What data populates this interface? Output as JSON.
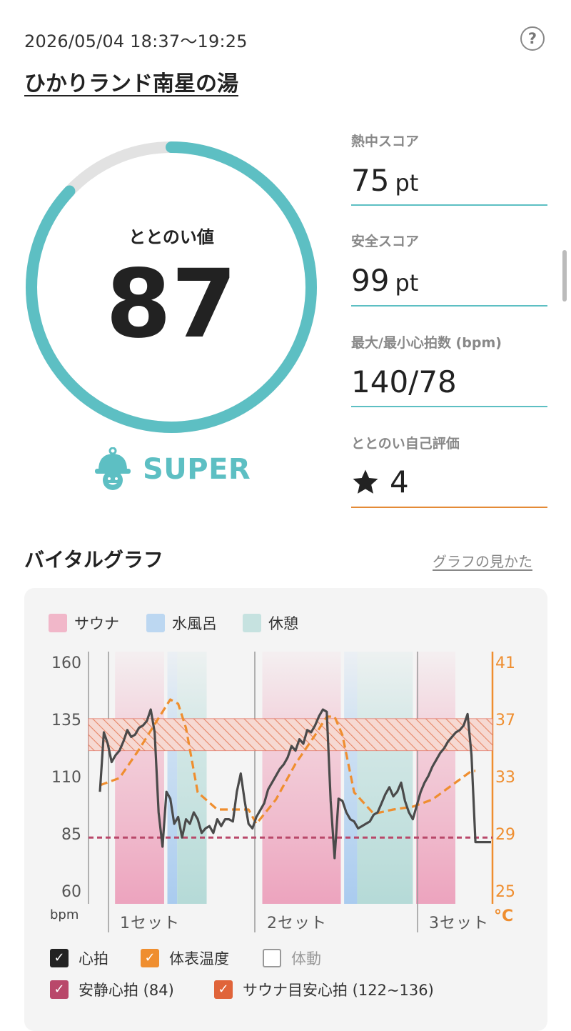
{
  "session": {
    "datetime": "2026/05/04 18:37〜19:25",
    "venue": "ひかりランド南星の湯",
    "help_icon": "question-circle-icon"
  },
  "score": {
    "label": "ととのい値",
    "value": "87",
    "progress": 0.87,
    "rank": "SUPER",
    "rank_icon": "sauna-hat-mascot-icon",
    "accent": "#5dbfc3",
    "track": "#e2e2e2"
  },
  "stats": [
    {
      "label": "熱中スコア",
      "value": "75",
      "unit": "pt",
      "line_color": "#5dbfc3"
    },
    {
      "label": "安全スコア",
      "value": "99",
      "unit": "pt",
      "line_color": "#5dbfc3"
    },
    {
      "label": "最大/最小心拍数 (bpm)",
      "value": "140/78",
      "unit": "",
      "line_color": "#5dbfc3"
    },
    {
      "label": "ととのい自己評価",
      "value": "4",
      "unit": "",
      "icon": "star-icon",
      "line_color": "#e48a36"
    }
  ],
  "vital": {
    "title": "バイタルグラフ",
    "guide_link": "グラフの見かた",
    "legend": [
      {
        "label": "サウナ",
        "color": "#f1b7c9"
      },
      {
        "label": "水風呂",
        "color": "#bcd7f1"
      },
      {
        "label": "休憩",
        "color": "#c6e2e0"
      }
    ],
    "toggles": [
      {
        "label": "心拍",
        "checked": true,
        "color": "#222222"
      },
      {
        "label": "体表温度",
        "checked": true,
        "color": "#ef8e2f"
      },
      {
        "label": "体動",
        "checked": false,
        "color": "#999999"
      },
      {
        "label": "安静心拍 (84)",
        "checked": true,
        "color": "#b9486a"
      },
      {
        "label": "サウナ目安心拍 (122~136)",
        "checked": true,
        "color": "#e0643a"
      }
    ]
  },
  "chart_data": {
    "type": "line",
    "y_left": {
      "unit": "bpm",
      "ticks": [
        160,
        135,
        110,
        85,
        60
      ],
      "range": [
        60,
        160
      ]
    },
    "y_right": {
      "unit": "°C",
      "ticks": [
        41,
        37,
        33,
        29,
        25
      ],
      "range": [
        25,
        41
      ]
    },
    "x_labels": [
      "1セット",
      "2セット",
      "3セット"
    ],
    "resting_hr": 84,
    "sauna_target_hr": [
      122,
      136
    ],
    "phases": [
      {
        "type": "サウナ",
        "start": 0.02,
        "end": 0.17
      },
      {
        "type": "水風呂",
        "start": 0.18,
        "end": 0.21
      },
      {
        "type": "休憩",
        "start": 0.21,
        "end": 0.3
      },
      {
        "type": "サウナ",
        "start": 0.47,
        "end": 0.71
      },
      {
        "type": "水風呂",
        "start": 0.72,
        "end": 0.76
      },
      {
        "type": "休憩",
        "start": 0.76,
        "end": 0.93
      },
      {
        "type": "サウナ",
        "start": 0.94,
        "end": 1.06
      },
      {
        "type": "水風呂",
        "start": 1.18,
        "end": 1.2
      }
    ],
    "series": [
      {
        "name": "心拍",
        "t": [
          0,
          1,
          2,
          3,
          4,
          5,
          6,
          7,
          8,
          9,
          10,
          11,
          12,
          13,
          14,
          15,
          16,
          17,
          18,
          19,
          20,
          21,
          22,
          23,
          24,
          25,
          26,
          27,
          28,
          29,
          30,
          31,
          32,
          33,
          34,
          35,
          36,
          37,
          38,
          39,
          40,
          41,
          42,
          43,
          44,
          45,
          46,
          47,
          48,
          49,
          50,
          51,
          52,
          53,
          54,
          55,
          56,
          57,
          58,
          59,
          60,
          61,
          62,
          63,
          64,
          65,
          66,
          67,
          68,
          69,
          70,
          71,
          72,
          73,
          74,
          75,
          76,
          77,
          78,
          79,
          80,
          81,
          82,
          83,
          84,
          85,
          86,
          87,
          88,
          89,
          90,
          91,
          92,
          93,
          94,
          95,
          96,
          97,
          98,
          99,
          100
        ],
        "values": [
          104,
          130,
          125,
          117,
          120,
          122,
          126,
          131,
          128,
          129,
          132,
          133,
          135,
          140,
          130,
          95,
          80,
          104,
          101,
          90,
          93,
          84,
          92,
          90,
          95,
          92,
          86,
          88,
          89,
          86,
          92,
          89,
          92,
          92,
          91,
          104,
          112,
          100,
          90,
          88,
          93,
          96,
          99,
          105,
          108,
          111,
          114,
          116,
          119,
          124,
          122,
          127,
          125,
          131,
          130,
          133,
          137,
          140,
          139,
          100,
          75,
          101,
          100,
          95,
          92,
          91,
          88,
          89,
          90,
          91,
          94,
          95,
          99,
          103,
          106,
          102,
          104,
          108,
          100,
          95,
          92,
          98,
          104,
          108,
          111,
          115,
          118,
          121,
          123,
          126,
          128,
          130,
          131,
          133,
          138,
          120,
          82,
          82,
          82,
          82,
          82
        ]
      },
      {
        "name": "体表温度",
        "t": [
          0,
          5,
          10,
          15,
          18,
          20,
          22,
          25,
          30,
          35,
          38,
          40,
          45,
          50,
          55,
          58,
          60,
          62,
          65,
          70,
          75,
          80,
          85,
          90,
          95,
          96
        ],
        "values": [
          32.5,
          33.0,
          35.0,
          37.2,
          38.5,
          38.2,
          36.5,
          32.0,
          30.8,
          30.8,
          30.8,
          29.8,
          31.5,
          34.0,
          36.0,
          37.3,
          37.3,
          36.0,
          32.0,
          30.5,
          30.8,
          31.0,
          31.5,
          32.5,
          33.5,
          33.5
        ]
      }
    ]
  }
}
